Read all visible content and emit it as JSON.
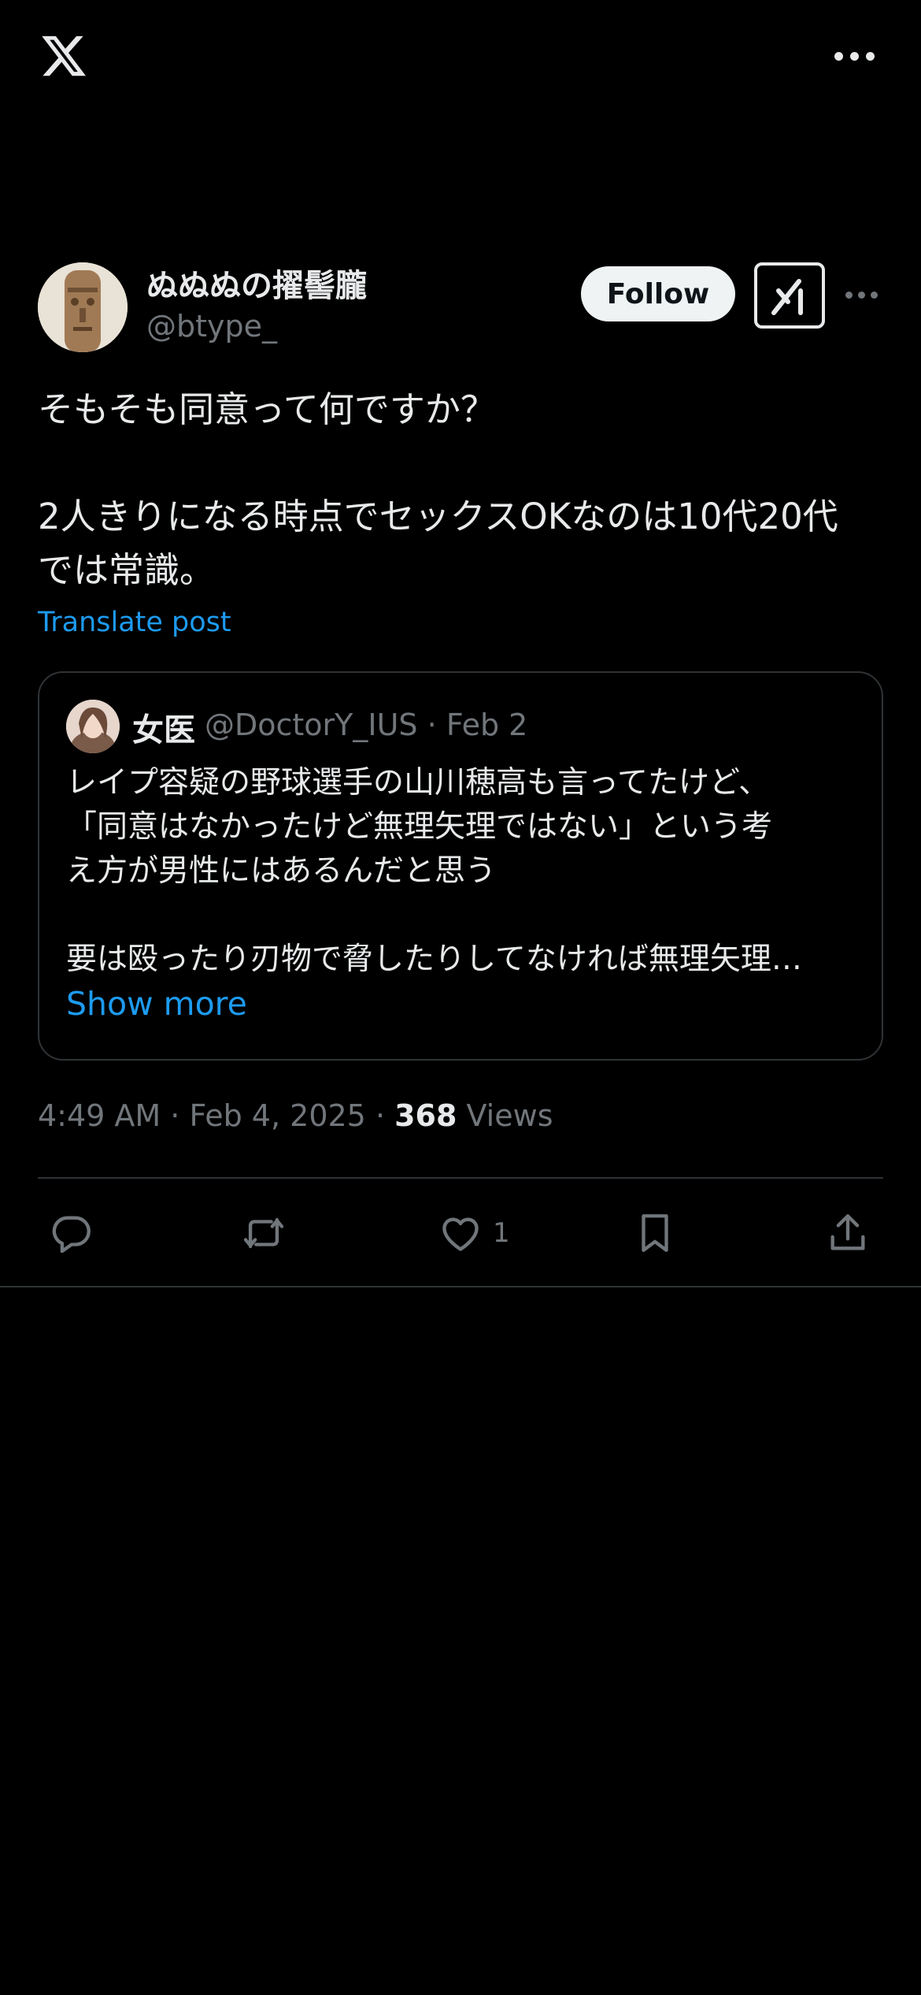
{
  "icons": {
    "logo": "x-logo-icon",
    "more": "more-horizontal-icon",
    "grok": "grok-icon",
    "reply": "reply-icon",
    "repost": "repost-icon",
    "like": "heart-icon",
    "bookmark": "bookmark-icon",
    "share": "share-icon"
  },
  "colors": {
    "background": "#000000",
    "link": "#1d9bf0",
    "muted": "#71767b",
    "text": "#e7e9ea",
    "border": "#2f3336"
  },
  "post": {
    "author": {
      "name": "ぬぬぬの擢髻朧",
      "handle": "@btype_"
    },
    "follow_label": "Follow",
    "body_lines": [
      "そもそも同意って何ですか？",
      "2人きりになる時点でセックスOKなのは10代20代",
      "では常識。"
    ],
    "translate_label": "Translate post",
    "quote": {
      "name": "女医",
      "handle": "@DoctorY_IUS",
      "separator": "·",
      "date": "Feb 2",
      "lines": [
        "レイプ容疑の野球選手の山川穂高も言ってたけど、",
        "「同意はなかったけど無理矢理ではない」という考",
        "え方が男性にはあるんだと思う",
        "要は殴ったり刃物で脅したりしてなければ無理矢理…"
      ],
      "show_more": "Show more"
    },
    "meta": {
      "time": "4:49 AM",
      "sep1": " · ",
      "date": "Feb 4, 2025",
      "sep2": " · ",
      "views_count": "368",
      "views_label": " Views"
    },
    "actions": {
      "likes": "1"
    }
  }
}
